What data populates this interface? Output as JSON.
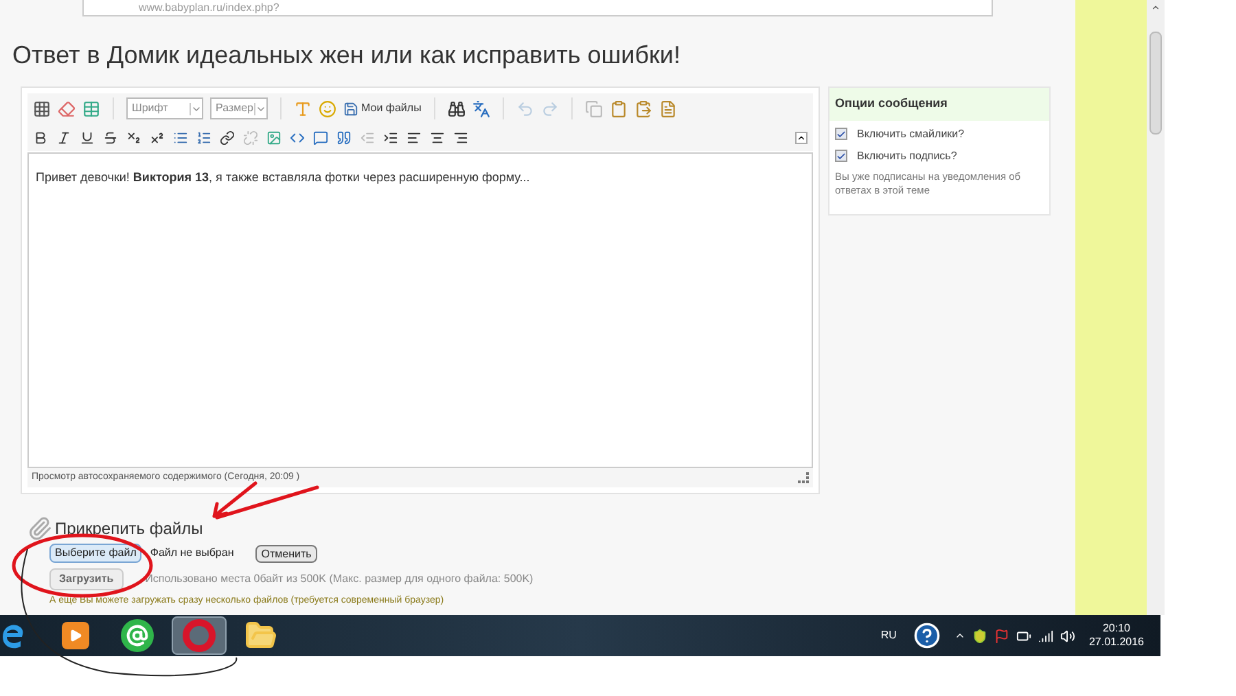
{
  "address_bar": {
    "url": "www.babyplan.ru/index.php?"
  },
  "page_title": "Ответ в Домик идеальных жен или как исправить ошибки!",
  "editor": {
    "font_select": "Шрифт",
    "size_select": "Размер",
    "my_files_button": "Мои файлы",
    "content": "Привет девочки! **Виктория 13**, я также вставляла фотки через расширенную форму...",
    "autosave_link": "Просмотр автосохраняемого содержимого (Сегодня, 20:09 )"
  },
  "options": {
    "title": "Опции сообщения",
    "checkboxes": [
      {
        "label": "Включить смайлики?",
        "checked": true
      },
      {
        "label": "Включить подпись?",
        "checked": true
      }
    ],
    "note": "Вы уже подписаны на уведомления об ответах в этой теме"
  },
  "attach": {
    "title": "Прикрепить файлы",
    "choose_button": "Выберите файл",
    "file_status": "Файл не выбран",
    "cancel_button": "Отменить",
    "upload_button": "Загрузить",
    "quota": "Использовано места 0байт из 500K (Макс. размер для одного файла: 500K)",
    "hint": "А еще Вы можете загружать сразу несколько файлов (требуется современный браузер)"
  },
  "taskbar": {
    "apps": [
      {
        "kind": "ie",
        "selected": false
      },
      {
        "kind": "media",
        "selected": false
      },
      {
        "kind": "agent",
        "selected": false
      },
      {
        "kind": "opera",
        "selected": true
      },
      {
        "kind": "folder",
        "selected": false
      }
    ],
    "language": "RU",
    "time": "20:10",
    "date": "27.01.2016"
  }
}
